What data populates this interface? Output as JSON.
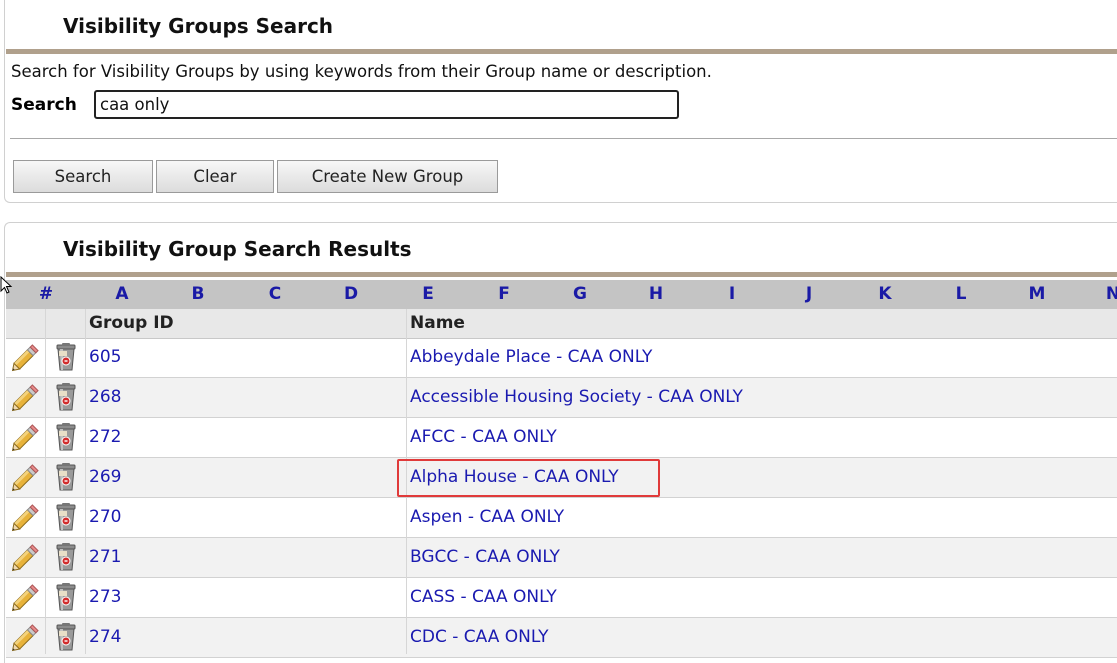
{
  "search_panel": {
    "title": "Visibility Groups Search",
    "help_text": "Search for Visibility Groups by using keywords from their Group name or description.",
    "search_label": "Search",
    "search_value": "caa only",
    "buttons": {
      "search": "Search",
      "clear": "Clear",
      "create": "Create New Group"
    }
  },
  "results_panel": {
    "title": "Visibility Group Search Results",
    "letters": [
      "#",
      "A",
      "B",
      "C",
      "D",
      "E",
      "F",
      "G",
      "H",
      "I",
      "J",
      "K",
      "L",
      "M",
      "N"
    ],
    "columns": {
      "group_id": "Group ID",
      "name": "Name"
    },
    "rows": [
      {
        "id": "605",
        "name": "Abbeydale Place - CAA ONLY"
      },
      {
        "id": "268",
        "name": "Accessible Housing Society - CAA ONLY"
      },
      {
        "id": "272",
        "name": "AFCC - CAA ONLY"
      },
      {
        "id": "269",
        "name": "Alpha House - CAA ONLY"
      },
      {
        "id": "270",
        "name": "Aspen - CAA ONLY"
      },
      {
        "id": "271",
        "name": "BGCC - CAA ONLY"
      },
      {
        "id": "273",
        "name": "CASS - CAA ONLY"
      },
      {
        "id": "274",
        "name": "CDC - CAA ONLY"
      }
    ],
    "row_icons": [
      "pencil-edit-icon",
      "trash-can-delete-icon"
    ]
  },
  "colors": {
    "link": "#1a1ab0",
    "letter": "#1a1aa6",
    "title_bar": "#b0a08c",
    "highlight": "#e03a3a"
  }
}
